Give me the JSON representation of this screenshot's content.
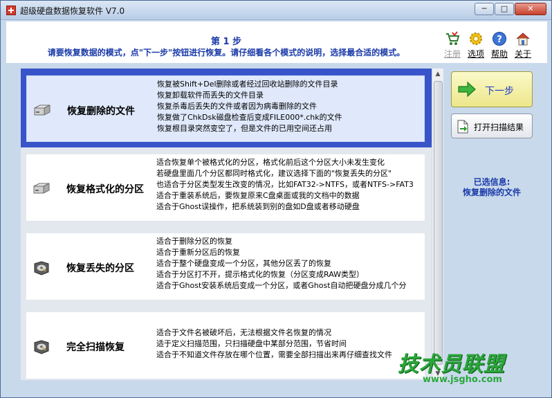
{
  "window": {
    "title": "超级硬盘数据恢复软件 V7.0",
    "controls": {
      "minimize": "─",
      "maximize": "□",
      "close": "✕"
    }
  },
  "header": {
    "step": "第 1 步",
    "instruction": "请要恢复数据的模式，点\"下一步\"按钮进行恢复。请仔细看各个模式的说明，选择最合适的模式。"
  },
  "toolbar": [
    {
      "label": "注册",
      "icon": "cart-icon",
      "enabled": false
    },
    {
      "label": "选项",
      "icon": "gear-icon",
      "enabled": true
    },
    {
      "label": "帮助",
      "icon": "help-icon",
      "enabled": true
    },
    {
      "label": "关于",
      "icon": "home-icon",
      "enabled": true
    }
  ],
  "options": [
    {
      "title": "恢复删除的文件",
      "selected": true,
      "icon": "disk-drive-icon",
      "desc": [
        "恢复被Shift+Del删除或者经过回收站删除的文件目录",
        "恢复卸载软件而丢失的文件目录",
        "恢复杀毒后丢失的文件或者因为病毒删除的文件",
        "恢复做了ChkDsk磁盘检查后变成FILE000*.chk的文件",
        "恢复根目录突然变空了，但是文件的已用空间还占用"
      ]
    },
    {
      "title": "恢复格式化的分区",
      "selected": false,
      "icon": "disk-drive-icon",
      "desc": [
        "适合恢复单个被格式化的分区，格式化前后这个分区大小未发生变化",
        "若硬盘里面几个分区都同时格式化，建议选择下面的\"恢复丢失的分区\"",
        "也适合于分区类型发生改变的情况，比如FAT32->NTFS，或者NTFS->FAT3",
        "适合于重装系统后，要恢复原来C盘桌面或我的文档中的数据",
        "适合于Ghost误操作，把系统装到别的盘如D盘或者移动硬盘"
      ]
    },
    {
      "title": "恢复丢失的分区",
      "selected": false,
      "icon": "hard-disk-icon",
      "desc": [
        "适合于删除分区的恢复",
        "适合于重新分区后的恢复",
        "适合于整个硬盘变成一个分区，其他分区丢了的恢复",
        "适合于分区打不开，提示格式化的恢复（分区变成RAW类型）",
        "适合于Ghost安装系统后变成一个分区，或者Ghost自动把硬盘分成几个分"
      ]
    },
    {
      "title": "完全扫描恢复",
      "selected": false,
      "icon": "hard-disk-icon",
      "desc": [
        "适合于文件名被破坏后，无法根据文件名恢复的情况",
        "适于定义扫描范围，只扫描硬盘中某部分范围，节省时间",
        "适合于不知道文件存放在哪个位置，需要全部扫描出来再仔细查找文件"
      ]
    }
  ],
  "actions": {
    "next": "下一步",
    "open_results": "打开扫描结果"
  },
  "selection": {
    "label": "已选信息:",
    "value": "恢复删除的文件"
  },
  "watermark": {
    "brand": "技术员联盟",
    "url": "www.jsgho.com"
  },
  "colors": {
    "accent_blue": "#1a3aa8",
    "selected_border": "#3954c9",
    "next_button": "#ece78a",
    "watermark_green": "#2aa63a"
  }
}
